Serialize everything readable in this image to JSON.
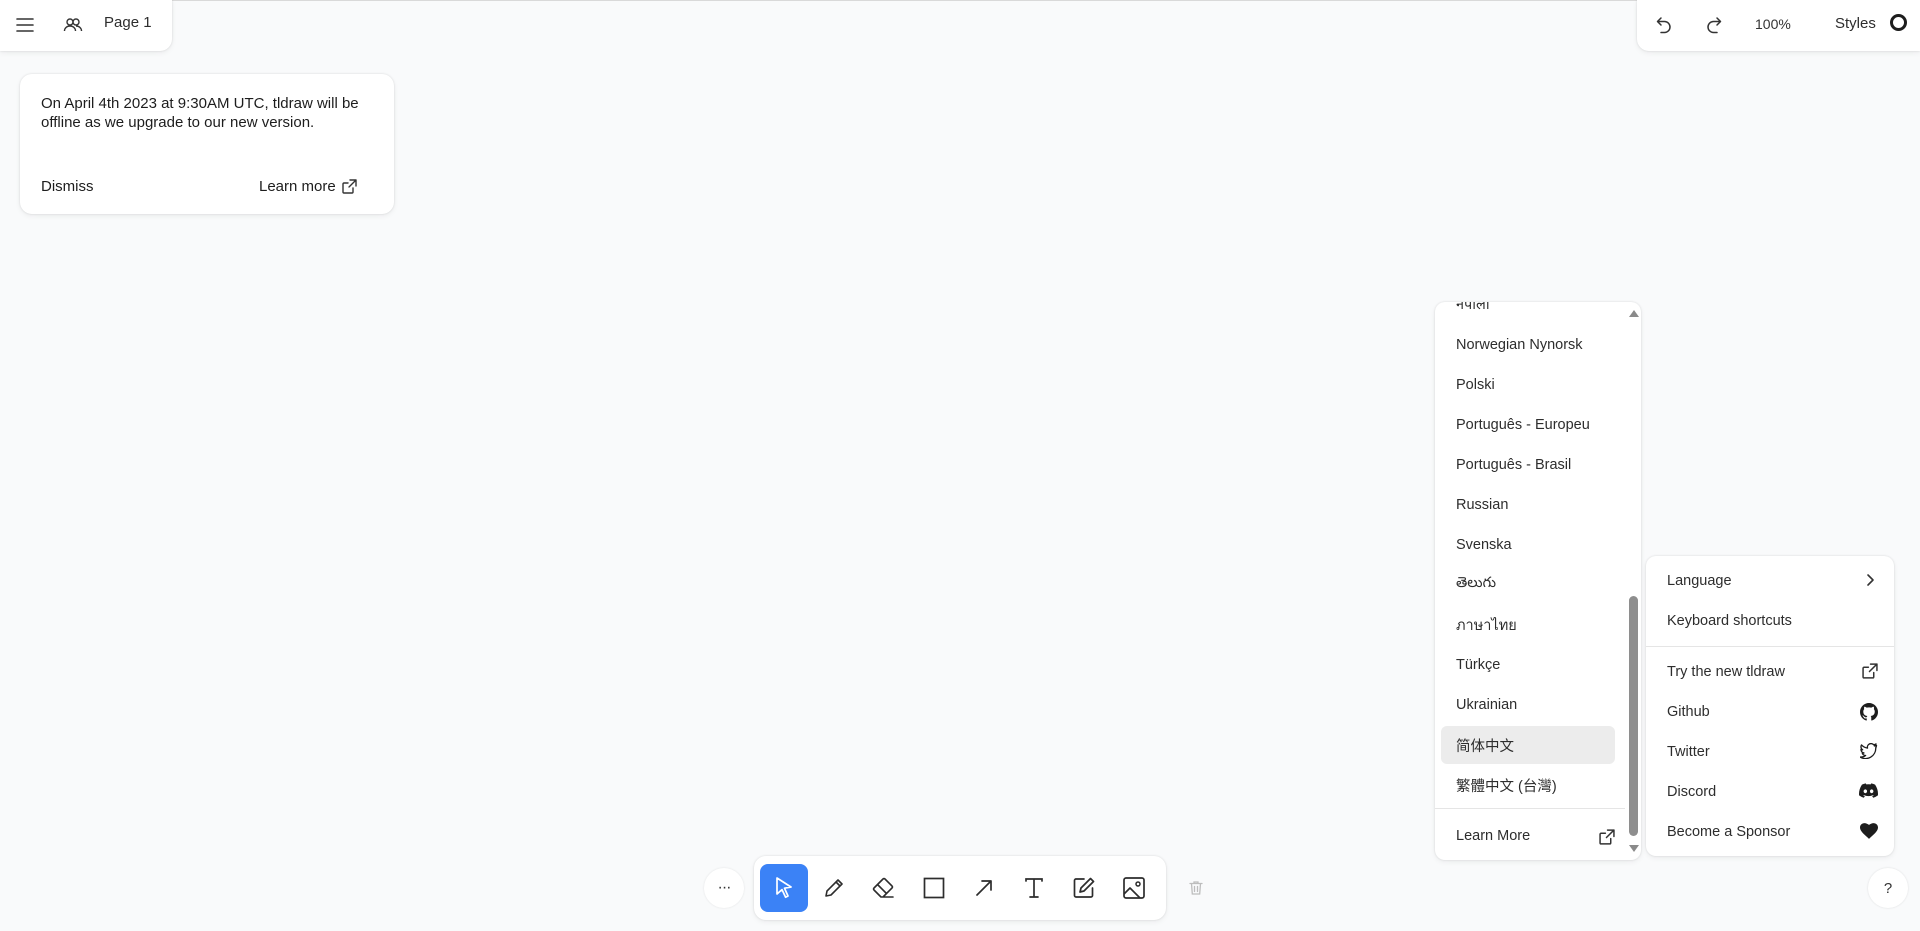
{
  "top_left": {
    "page_label": "Page 1",
    "menu_icon": "hamburger-menu-icon",
    "people_icon": "people-icon"
  },
  "top_right": {
    "undo_icon": "undo-icon",
    "redo_icon": "redo-icon",
    "zoom_label": "100%",
    "styles_label": "Styles"
  },
  "notice": {
    "text": "On April 4th 2023 at 9:30AM UTC, tldraw will be offline as we upgrade to our new version.",
    "dismiss_label": "Dismiss",
    "learn_more_label": "Learn more"
  },
  "language_menu": {
    "items": [
      {
        "label": "नेपाली"
      },
      {
        "label": "Norwegian Nynorsk"
      },
      {
        "label": "Polski"
      },
      {
        "label": "Português - Europeu"
      },
      {
        "label": "Português - Brasil"
      },
      {
        "label": "Russian"
      },
      {
        "label": "Svenska"
      },
      {
        "label": "తెలుగు"
      },
      {
        "label": "ภาษาไทย"
      },
      {
        "label": "Türkçe"
      },
      {
        "label": "Ukrainian"
      },
      {
        "label": "简体中文"
      },
      {
        "label": "繁體中文 (台灣)"
      }
    ],
    "selected": "简体中文",
    "learn_more_label": "Learn More"
  },
  "help_menu": {
    "items": [
      {
        "label": "Language",
        "icon": "chevron-right-icon"
      },
      {
        "label": "Keyboard shortcuts",
        "icon": ""
      },
      {
        "label": "Try the new tldraw",
        "icon": "external-link-icon"
      },
      {
        "label": "Github",
        "icon": "github-icon"
      },
      {
        "label": "Twitter",
        "icon": "twitter-icon"
      },
      {
        "label": "Discord",
        "icon": "discord-icon"
      },
      {
        "label": "Become a Sponsor",
        "icon": "heart-icon"
      }
    ]
  },
  "toolbar": {
    "more_label": "···",
    "active_tool": "select",
    "tools": [
      "select",
      "draw",
      "eraser",
      "rectangle",
      "arrow",
      "text",
      "sticky-note",
      "image"
    ]
  },
  "help_button_label": "?",
  "colors": {
    "accent": "#3b82f6",
    "background": "#f9fafb",
    "panel": "#ffffff"
  }
}
